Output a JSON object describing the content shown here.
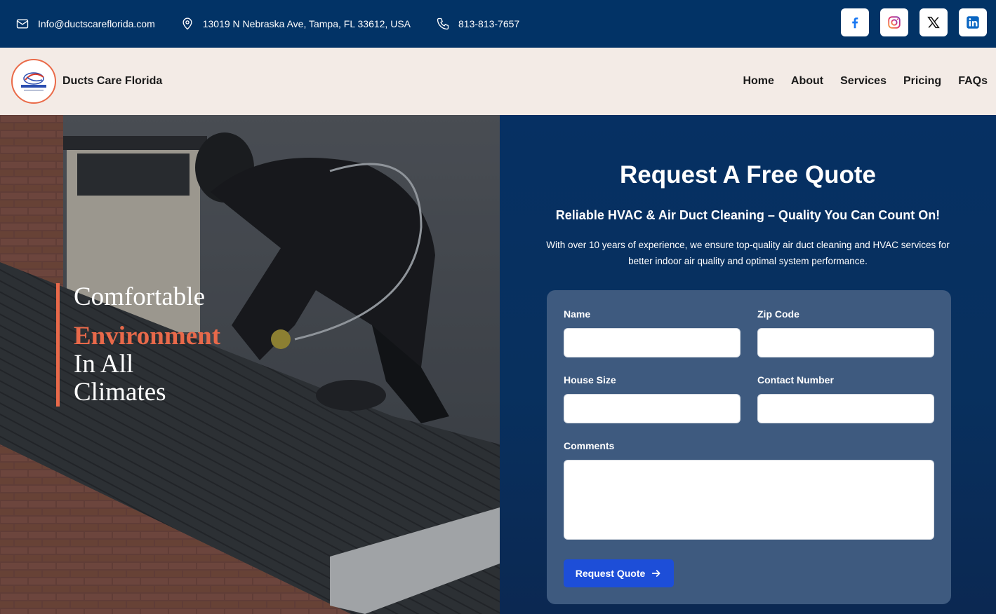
{
  "topbar": {
    "email": "Info@ductscareflorida.com",
    "address": "13019 N Nebraska Ave, Tampa, FL 33612, USA",
    "phone": "813-813-7657",
    "socials": [
      "facebook-icon",
      "instagram-icon",
      "x-icon",
      "linkedin-icon"
    ]
  },
  "navbar": {
    "brand": "Ducts Care Florida",
    "logo_text": "DUCTS CARE FLORIDA",
    "menu": [
      "Home",
      "About",
      "Services",
      "Pricing",
      "FAQs"
    ]
  },
  "hero": {
    "line1": "Comfortable",
    "line2": "Environment",
    "line3": "In All",
    "line4": "Climates"
  },
  "quote": {
    "title": "Request A Free Quote",
    "subtitle": "Reliable HVAC & Air Duct Cleaning – Quality You Can Count On!",
    "description": "With over 10 years of experience, we ensure top-quality air duct cleaning and HVAC services for better indoor air quality and optimal system performance.",
    "fields": {
      "name": "Name",
      "zip": "Zip Code",
      "house_size": "House Size",
      "contact_number": "Contact Number",
      "comments": "Comments"
    },
    "button": "Request Quote"
  },
  "colors": {
    "topbar": "#023366",
    "navbar": "#f3ebe6",
    "accent": "#e8694a",
    "button": "#1d4ed8"
  }
}
